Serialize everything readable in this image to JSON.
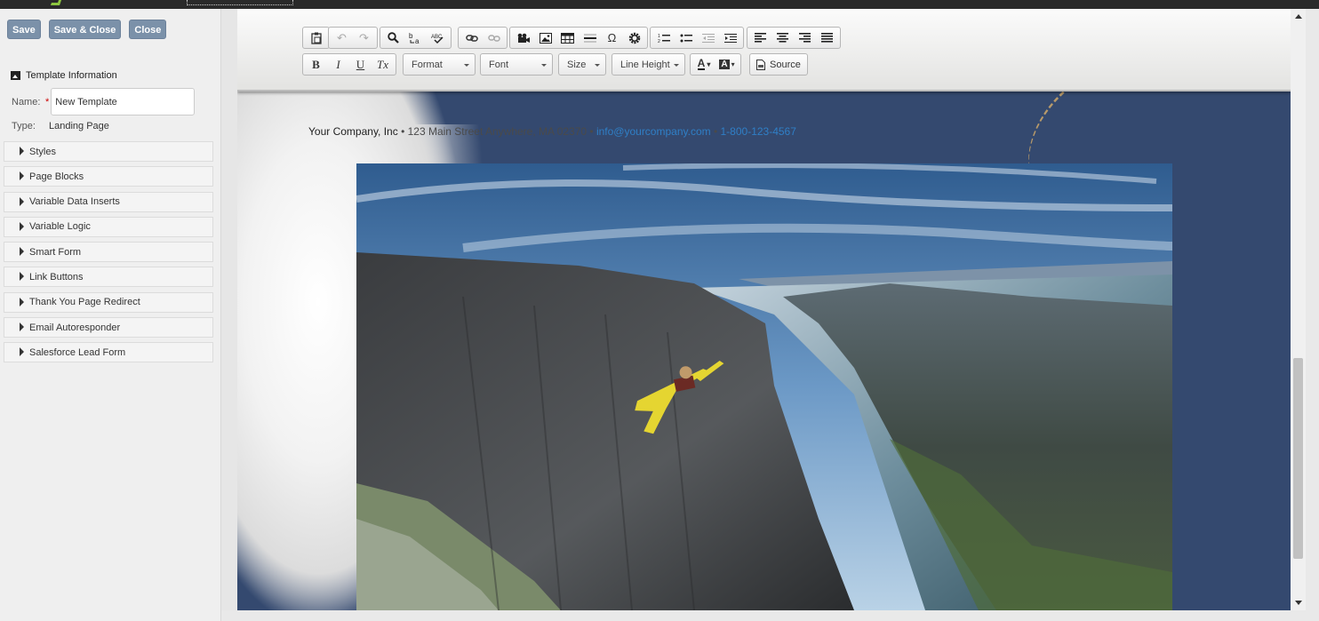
{
  "actions": {
    "save": "Save",
    "save_close": "Save & Close",
    "close": "Close"
  },
  "template_info": {
    "heading": "Template Information",
    "name_label": "Name:",
    "required_mark": "*",
    "name_value": "New Template",
    "type_label": "Type:",
    "type_value": "Landing Page"
  },
  "sections": [
    {
      "label": "Styles"
    },
    {
      "label": "Page Blocks"
    },
    {
      "label": "Variable Data Inserts"
    },
    {
      "label": "Variable Logic"
    },
    {
      "label": "Smart Form"
    },
    {
      "label": "Link Buttons"
    },
    {
      "label": "Thank You Page Redirect"
    },
    {
      "label": "Email Autoresponder"
    },
    {
      "label": "Salesforce Lead Form"
    }
  ],
  "toolbar": {
    "format": "Format",
    "font": "Font",
    "size": "Size",
    "line_height": "Line Height",
    "source": "Source",
    "bold": "B",
    "italic": "I",
    "underline": "U",
    "remove_format": "Tx",
    "special_char": "Ω",
    "text_color": "A",
    "bg_color": "A"
  },
  "content": {
    "company": "Your Company, Inc",
    "address": " • 123 Main Street Anywhere, MA 02370 • ",
    "email": "info@yourcompany.com",
    "separator": " • ",
    "phone": "1-800-123-4567"
  },
  "colors": {
    "button_bg": "#7b91a9",
    "canvas_bg": "#34496f",
    "link": "#2f7fc6"
  }
}
